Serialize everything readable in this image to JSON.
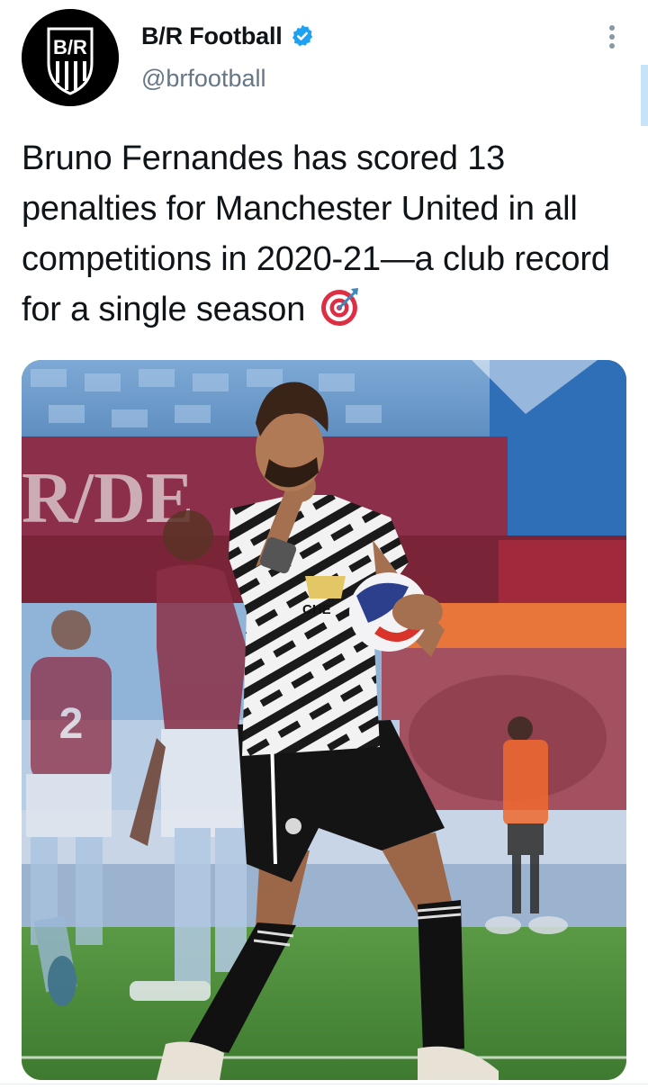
{
  "account": {
    "display_name": "B/R Football",
    "handle": "@brfootball",
    "verified": true,
    "avatar_icon": "br-shield-logo",
    "avatar_logo_text": "B/R"
  },
  "tweet": {
    "text": "Bruno Fernandes has scored 13 penalties for Manchester United in all competitions in 2020-21—a club record for a single season",
    "emoji": "direct-hit-target-icon"
  },
  "media": {
    "type": "photo",
    "background_sign_text": "R/DE",
    "shirt_sponsor_text": "CHE"
  },
  "colors": {
    "verified_blue": "#1da1f2",
    "handle_gray": "#657786",
    "text": "#0f1419"
  }
}
